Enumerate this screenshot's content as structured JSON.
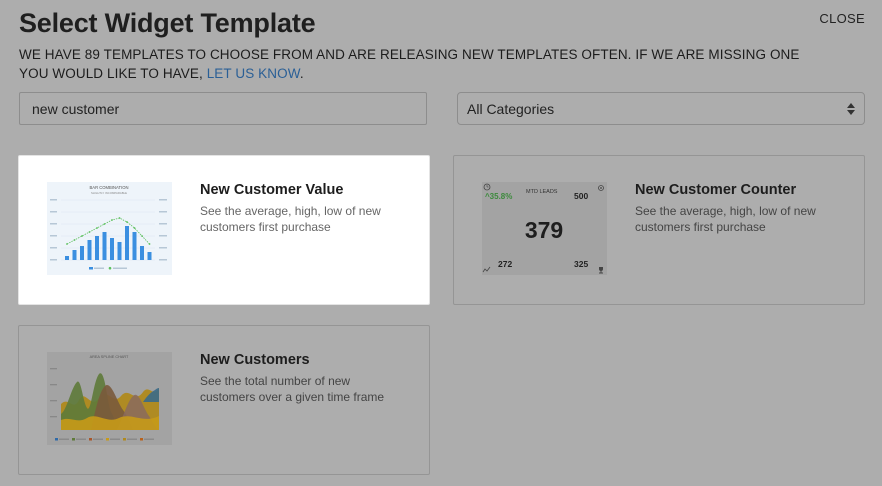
{
  "dialog": {
    "title": "Select Widget Template",
    "close_label": "CLOSE",
    "subtitle_text": "WE HAVE 89 TEMPLATES TO CHOOSE FROM AND ARE RELEASING NEW TEMPLATES OFTEN. IF WE ARE MISSING ONE YOU WOULD LIKE TO HAVE, ",
    "subtitle_link": "LET US KNOW",
    "subtitle_end": "."
  },
  "search": {
    "value": "new customer"
  },
  "category": {
    "selected": "All Categories"
  },
  "templates": [
    {
      "title": "New Customer Value",
      "description": "See the average, high, low of new customers first purchase",
      "selected": true,
      "thumbnail": {
        "kind": "bar-combination",
        "heading": "BAR COMBINATION",
        "subheading": "SLIGHTLY INCOMPARABLE",
        "accent_color": "#3b8fe0",
        "line_color": "#5cc05c"
      }
    },
    {
      "title": "New Customer Counter",
      "description": "See the average, high, low of new customers first purchase",
      "selected": false,
      "thumbnail": {
        "kind": "counter",
        "change": "35.8%",
        "label": "MTD LEADS",
        "main_value": "379",
        "top_right": "500",
        "bottom_left": "272",
        "bottom_right": "325",
        "change_color": "#3c8a3c"
      }
    },
    {
      "title": "New Customers",
      "description": "See the total number of new customers over a given time frame",
      "selected": false,
      "thumbnail": {
        "kind": "area-spline",
        "heading": "AREA SPLINE CHART"
      }
    }
  ]
}
